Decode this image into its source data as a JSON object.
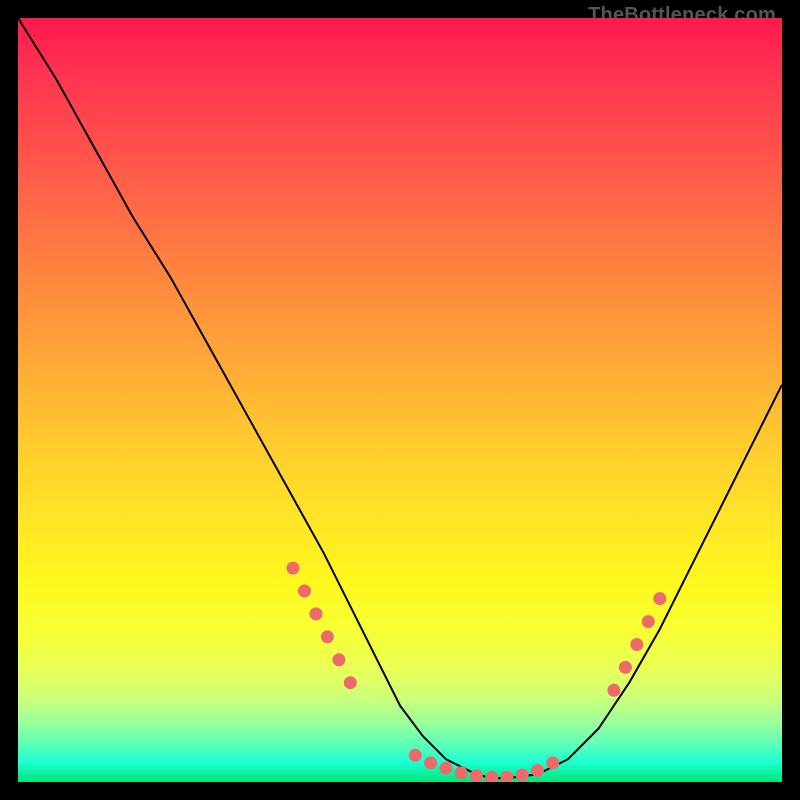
{
  "watermark": "TheBottleneck.com",
  "chart_data": {
    "type": "line",
    "title": "",
    "xlabel": "",
    "ylabel": "",
    "xlim": [
      0,
      100
    ],
    "ylim": [
      0,
      100
    ],
    "grid": false,
    "legend": false,
    "series": [
      {
        "name": "curve",
        "x": [
          0,
          5,
          10,
          15,
          20,
          25,
          30,
          35,
          40,
          45,
          48,
          50,
          53,
          56,
          60,
          62,
          64,
          68,
          72,
          76,
          80,
          84,
          88,
          92,
          96,
          100
        ],
        "y": [
          100,
          92,
          83,
          74,
          66,
          57,
          48,
          39,
          30,
          20,
          14,
          10,
          6,
          3,
          1,
          0.5,
          0.5,
          1,
          3,
          7,
          13,
          20,
          28,
          36,
          44,
          52
        ]
      }
    ],
    "markers": {
      "name": "dots",
      "color": "#ed6a6a",
      "points": [
        {
          "x": 36,
          "y": 28
        },
        {
          "x": 37.5,
          "y": 25
        },
        {
          "x": 39,
          "y": 22
        },
        {
          "x": 40.5,
          "y": 19
        },
        {
          "x": 42,
          "y": 16
        },
        {
          "x": 43.5,
          "y": 13
        },
        {
          "x": 52,
          "y": 3.5
        },
        {
          "x": 54,
          "y": 2.5
        },
        {
          "x": 56,
          "y": 1.8
        },
        {
          "x": 58,
          "y": 1.2
        },
        {
          "x": 60,
          "y": 0.8
        },
        {
          "x": 62,
          "y": 0.6
        },
        {
          "x": 64,
          "y": 0.6
        },
        {
          "x": 66,
          "y": 0.9
        },
        {
          "x": 68,
          "y": 1.5
        },
        {
          "x": 70,
          "y": 2.5
        },
        {
          "x": 78,
          "y": 12
        },
        {
          "x": 79.5,
          "y": 15
        },
        {
          "x": 81,
          "y": 18
        },
        {
          "x": 82.5,
          "y": 21
        },
        {
          "x": 84,
          "y": 24
        }
      ]
    }
  }
}
